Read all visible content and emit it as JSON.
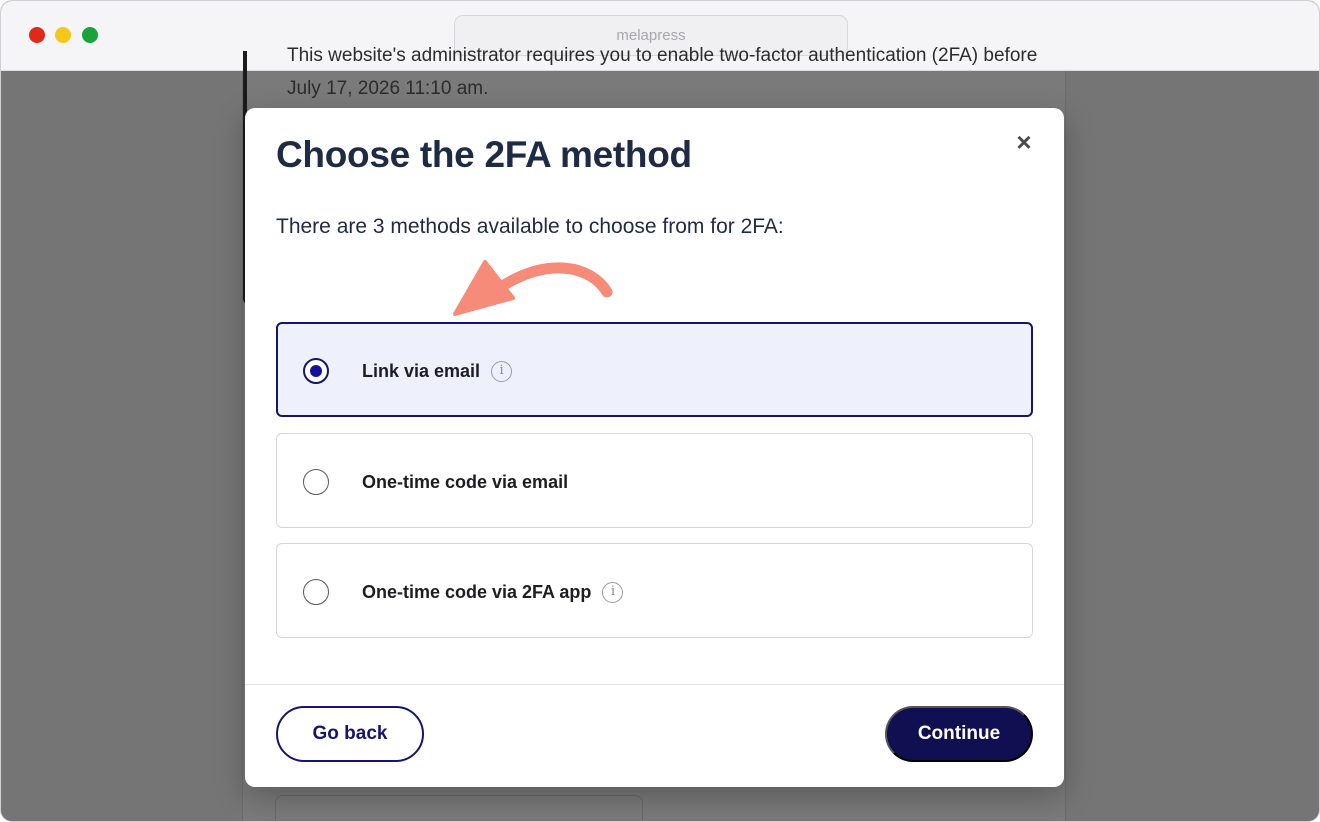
{
  "browser": {
    "url": "melapress"
  },
  "background": {
    "notice_text": "This website's administrator requires you to enable two-factor authentication (2FA) before July 17, 2026 11:10 am."
  },
  "modal": {
    "title": "Choose the 2FA method",
    "subtitle": "There are 3 methods available to choose from for 2FA:",
    "close_icon": "×",
    "options": [
      {
        "label": "Link via email",
        "selected": true,
        "info_icon": "i"
      },
      {
        "label": "One-time code via email",
        "selected": false
      },
      {
        "label": "One-time code via 2FA app",
        "selected": false,
        "info_icon": "i"
      }
    ],
    "buttons": {
      "back": "Go back",
      "continue": "Continue"
    }
  },
  "colors": {
    "primary": "#14156b",
    "continue_bg": "#0f0f52",
    "selected_bg": "#eef1fc",
    "arrow": "#f58b78",
    "heading": "#1f2a44"
  }
}
